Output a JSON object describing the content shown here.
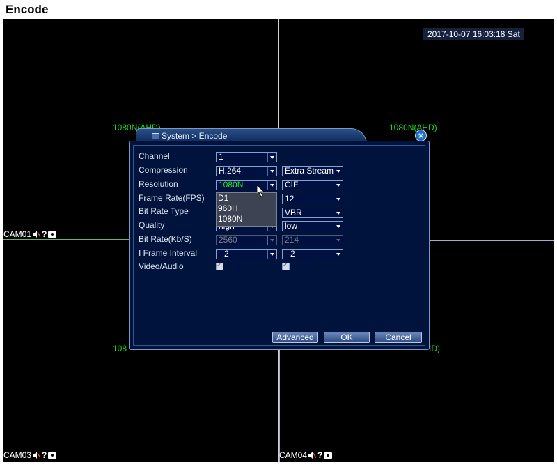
{
  "page": {
    "title": "Encode"
  },
  "screen": {
    "datetime": "2017-10-07 16:03:18 Sat",
    "resolution_labels": [
      "1080N(AHD)",
      "1080N(AHD)",
      "108",
      "ID)"
    ],
    "cameras": [
      {
        "name": "CAM01"
      },
      {
        "name": "CAM03"
      },
      {
        "name": "CAM04"
      }
    ]
  },
  "dialog": {
    "title": "System > Encode",
    "close_label": "×",
    "labels": {
      "channel": "Channel",
      "compression": "Compression",
      "resolution": "Resolution",
      "frame_rate": "Frame Rate(FPS)",
      "bit_rate_type": "Bit Rate Type",
      "quality": "Quality",
      "bit_rate": "Bit Rate(Kb/S)",
      "i_frame_interval": "I Frame Interval",
      "video_audio": "Video/Audio"
    },
    "main_stream": {
      "channel": "1",
      "compression": "H.264",
      "resolution": "1080N",
      "quality": "high",
      "bit_rate": "2560",
      "i_frame_interval": "2",
      "video_checked": true,
      "audio_checked": false
    },
    "extra_stream": {
      "type": "Extra Stream",
      "resolution": "CIF",
      "frame_rate": "12",
      "bit_rate_type": "VBR",
      "quality": "low",
      "bit_rate": "214",
      "i_frame_interval": "2",
      "video_checked": true,
      "audio_checked": false
    },
    "resolution_dropdown": {
      "options": [
        "D1",
        "960H",
        "1080N"
      ]
    },
    "buttons": {
      "advanced": "Advanced",
      "ok": "OK",
      "cancel": "Cancel"
    }
  },
  "colors": {
    "screen_bg": "#000000",
    "dialog_bg": "#00133d",
    "osd_green": "#1fd51f"
  }
}
